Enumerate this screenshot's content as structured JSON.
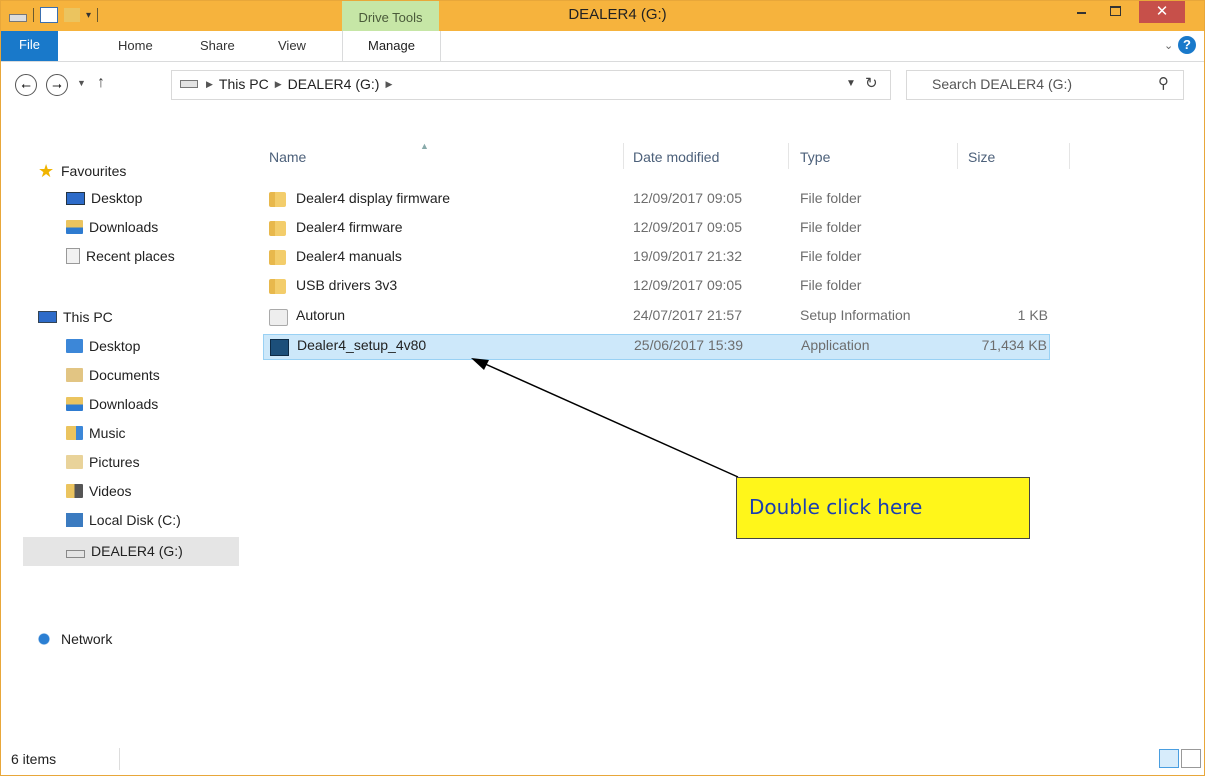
{
  "window": {
    "title": "DEALER4 (G:)",
    "close_glyph": "✕"
  },
  "ribbon": {
    "contextual_label": "Drive Tools",
    "tabs": [
      "File",
      "Home",
      "Share",
      "View",
      "Manage"
    ],
    "expand_glyph": "⌄",
    "help_glyph": "?"
  },
  "address": {
    "crumbs": [
      "This PC",
      "DEALER4 (G:)"
    ],
    "search_placeholder": "Search DEALER4 (G:)"
  },
  "nav": {
    "favourites": "Favourites",
    "fav_items": [
      "Desktop",
      "Downloads",
      "Recent places"
    ],
    "this_pc": "This PC",
    "pc_items": [
      "Desktop",
      "Documents",
      "Downloads",
      "Music",
      "Pictures",
      "Videos",
      "Local Disk (C:)",
      "DEALER4 (G:)"
    ],
    "network": "Network"
  },
  "columns": {
    "name": "Name",
    "date": "Date modified",
    "type": "Type",
    "size": "Size"
  },
  "files": [
    {
      "name": "Dealer4 display firmware",
      "date": "12/09/2017 09:05",
      "type": "File folder",
      "size": "",
      "icon": "folder-icon"
    },
    {
      "name": "Dealer4 firmware",
      "date": "12/09/2017 09:05",
      "type": "File folder",
      "size": "",
      "icon": "folder-icon"
    },
    {
      "name": "Dealer4 manuals",
      "date": "19/09/2017 21:32",
      "type": "File folder",
      "size": "",
      "icon": "folder-icon"
    },
    {
      "name": "USB drivers 3v3",
      "date": "12/09/2017 09:05",
      "type": "File folder",
      "size": "",
      "icon": "folder-icon"
    },
    {
      "name": "Autorun",
      "date": "24/07/2017 21:57",
      "type": "Setup Information",
      "size": "1 KB",
      "icon": "setup-info-icon"
    },
    {
      "name": "Dealer4_setup_4v80",
      "date": "25/06/2017 15:39",
      "type": "Application",
      "size": "71,434 KB",
      "icon": "application-icon"
    }
  ],
  "status": {
    "item_count": "6 items"
  },
  "callout": {
    "text": "Double click here"
  }
}
